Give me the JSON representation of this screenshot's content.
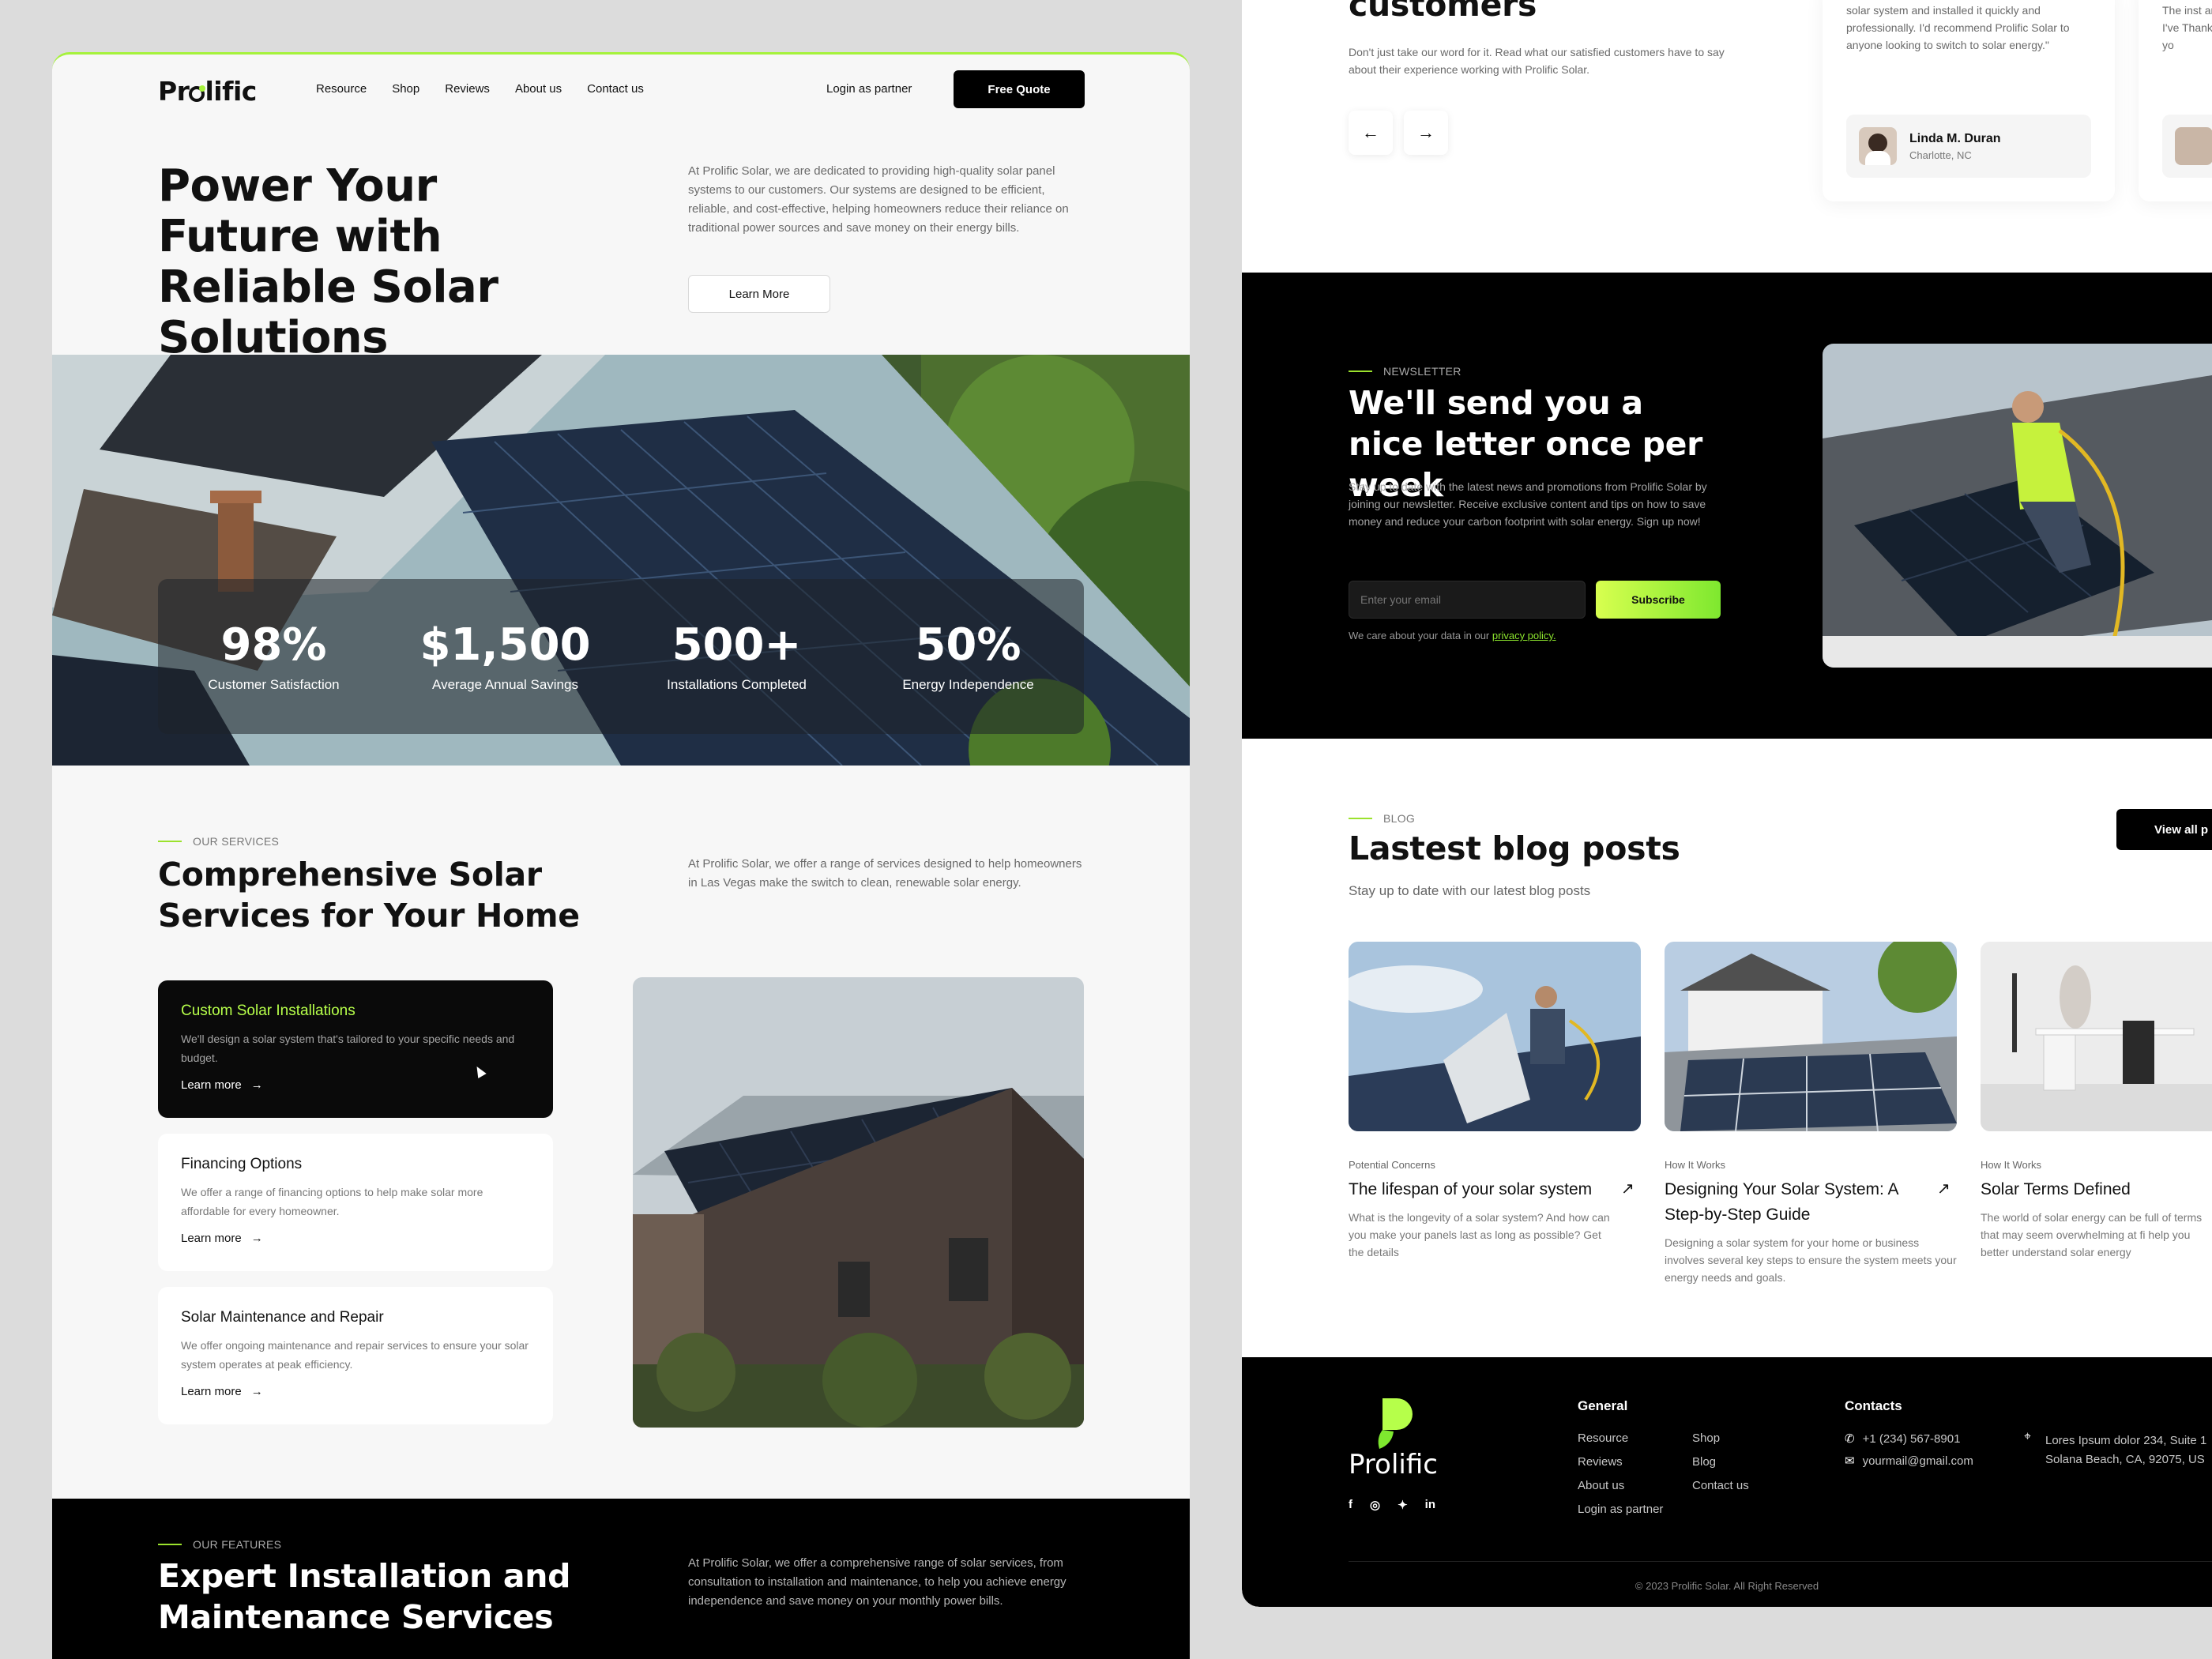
{
  "brand": {
    "name": "Prolific",
    "accent": "#a6f23c",
    "dark": "#0a0a0a"
  },
  "nav": {
    "links": [
      "Resource",
      "Shop",
      "Reviews",
      "About us",
      "Contact us"
    ],
    "login": "Login as partner",
    "cta": "Free Quote"
  },
  "hero": {
    "title": "Power Your Future with Reliable Solar Solutions",
    "desc": "At Prolific Solar, we are dedicated to providing high-quality solar panel systems to our customers. Our systems are designed to be efficient, reliable, and cost-effective, helping homeowners reduce their reliance on traditional power sources and save money on their energy bills.",
    "button": "Learn More"
  },
  "stats": [
    {
      "value": "98%",
      "label": "Customer Satisfaction"
    },
    {
      "value": "$1,500",
      "label": "Average Annual Savings"
    },
    {
      "value": "500+",
      "label": "Installations Completed"
    },
    {
      "value": "50%",
      "label": "Energy Independence"
    }
  ],
  "services": {
    "eyebrow": "OUR SERVICES",
    "title": "Comprehensive Solar Services for Your Home",
    "desc": "At Prolific Solar, we offer a range of services designed to help homeowners in Las Vegas make the switch to clean, renewable solar energy.",
    "items": [
      {
        "title": "Custom Solar Installations",
        "desc": "We'll design a solar system that's tailored to your specific needs and budget.",
        "link": "Learn more"
      },
      {
        "title": "Financing Options",
        "desc": "We offer a range of financing options to help make solar more affordable for every homeowner.",
        "link": "Learn more"
      },
      {
        "title": "Solar Maintenance and Repair",
        "desc": "We offer ongoing maintenance and repair services to ensure your solar system operates at peak efficiency.",
        "link": "Learn more"
      }
    ]
  },
  "features": {
    "eyebrow": "OUR FEATURES",
    "title": "Expert Installation and Maintenance Services",
    "desc": "At Prolific Solar, we offer a comprehensive range of solar services, from consultation to installation and maintenance, to help you achieve energy independence and save money on your monthly power bills."
  },
  "testimonials": {
    "title": "customers",
    "desc": "Don't just take our word for it. Read what our satisfied customers have to say about their experience working with Prolific Solar.",
    "quote": "solar system and installed it quickly and professionally. I'd recommend Prolific Solar to anyone looking to switch to solar energy.\"",
    "name": "Linda M. Duran",
    "location": "Charlotte, NC",
    "next_quote": "The inst and I've Thank yo"
  },
  "newsletter": {
    "eyebrow": "NEWSLETTER",
    "title": "We'll send you a nice letter once per week",
    "desc": "Stay up to date with the latest news and promotions from Prolific Solar by joining our newsletter. Receive exclusive content and tips on how to save money and reduce your carbon footprint with solar energy. Sign up now!",
    "placeholder": "Enter your email",
    "button": "Subscribe",
    "note": "We care about your data in our",
    "note_link": "privacy policy."
  },
  "blog": {
    "eyebrow": "BLOG",
    "title": "Lastest blog posts",
    "desc": "Stay up to date with our latest blog posts",
    "view_all": "View all p",
    "posts": [
      {
        "category": "Potential Concerns",
        "title": "The lifespan of your solar system",
        "desc": "What is the longevity of a solar system? And how can you make your panels last as long as possible? Get the details"
      },
      {
        "category": "How It Works",
        "title": "Designing Your Solar System: A Step-by-Step Guide",
        "desc": "Designing a solar system for your home or business involves several key steps to ensure the system meets your energy needs and goals."
      },
      {
        "category": "How It Works",
        "title": "Solar Terms Defined",
        "desc": "The world of solar energy can be full of terms that may seem overwhelming at fi help you better understand solar energy"
      }
    ]
  },
  "footer": {
    "logo": "Prolific",
    "general_title": "General",
    "general_col1": [
      "Resource",
      "Reviews",
      "About us",
      "Login as partner"
    ],
    "general_col2": [
      "Shop",
      "Blog",
      "Contact us"
    ],
    "contacts_title": "Contacts",
    "phone": "+1 (234) 567-8901",
    "email": "yourmail@gmail.com",
    "address1": "Lores Ipsum dolor 234, Suite 1",
    "address2": "Solana Beach, CA, 92075, US",
    "copyright": "© 2023 Prolific Solar. All Right Reserved"
  }
}
